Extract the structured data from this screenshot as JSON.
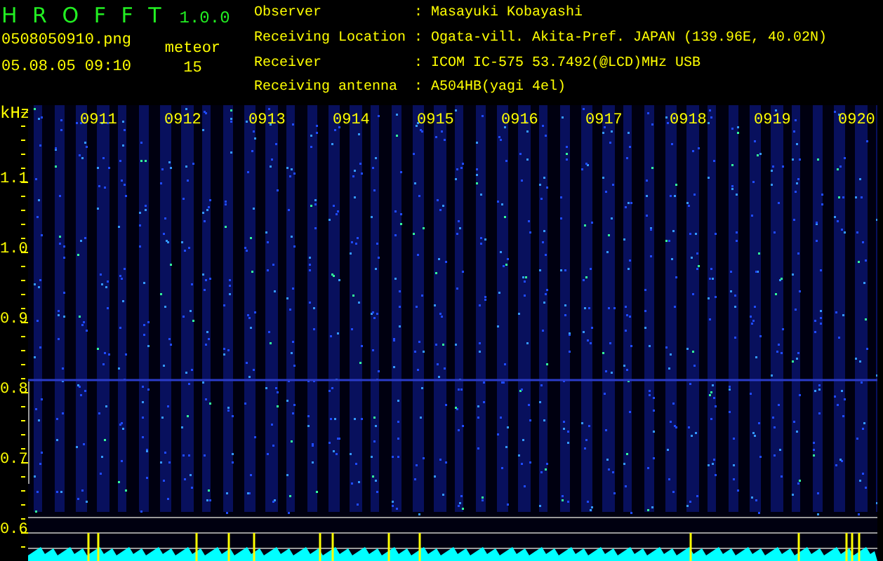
{
  "app": {
    "title": "H R O F F T",
    "version": "1.0.0",
    "file": "0508050910.png",
    "datetime": "05.08.05 09:10",
    "count_label": "meteor",
    "count": "15"
  },
  "info": [
    {
      "label": "Observer",
      "separator": ":",
      "value": "Masayuki Kobayashi"
    },
    {
      "label": "Receiving Location",
      "separator": ":",
      "value": "Ogata-vill. Akita-Pref. JAPAN (139.96E, 40.02N)"
    },
    {
      "label": "Receiver",
      "separator": ":",
      "value": "ICOM IC-575 53.7492(@LCD)MHz USB"
    },
    {
      "label": "Receiving antenna",
      "separator": ":",
      "value": "A504HB(yagi 4el)"
    }
  ],
  "plot": {
    "unit": "kHz",
    "y_labels": [
      "1.1",
      "1.0",
      "0.9",
      "0.8",
      "0.7",
      "0.6"
    ],
    "time_labels": [
      "0911",
      "0912",
      "0913",
      "0914",
      "0915",
      "0916",
      "0917",
      "0918",
      "0919",
      "0920"
    ]
  }
}
